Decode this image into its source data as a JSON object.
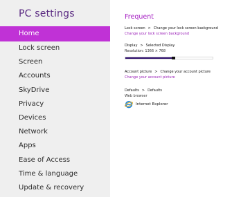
{
  "sidebar": {
    "title": "PC settings",
    "items": [
      {
        "label": "Home",
        "selected": true
      },
      {
        "label": "Lock screen",
        "selected": false
      },
      {
        "label": "Screen",
        "selected": false
      },
      {
        "label": "Accounts",
        "selected": false
      },
      {
        "label": "SkyDrive",
        "selected": false
      },
      {
        "label": "Privacy",
        "selected": false
      },
      {
        "label": "Devices",
        "selected": false
      },
      {
        "label": "Network",
        "selected": false
      },
      {
        "label": "Apps",
        "selected": false
      },
      {
        "label": "Ease of Access",
        "selected": false
      },
      {
        "label": "Time & language",
        "selected": false
      },
      {
        "label": "Update & recovery",
        "selected": false
      }
    ]
  },
  "main": {
    "section_title": "Frequent",
    "lock_screen": {
      "crumb_a": "Lock screen",
      "separator": ">",
      "crumb_b": "Change your lock screen background",
      "link": "Change your lock screen background"
    },
    "display": {
      "crumb_a": "Display",
      "separator": ">",
      "crumb_b": "Selected Display",
      "resolution": "Resolution: 1366 × 768",
      "resolution_level": 0.55
    },
    "account_picture": {
      "crumb_a": "Account picture",
      "separator": ">",
      "crumb_b": "Change your account picture",
      "link": "Change your account picture"
    },
    "defaults": {
      "crumb_a": "Defaults",
      "separator": ">",
      "crumb_b": "Defaults",
      "label": "Web browser",
      "app_name": "Internet Explorer",
      "app_icon": "internet-explorer-icon"
    }
  },
  "colors": {
    "sidebar_bg": "#efefef",
    "accent": "#c032d6",
    "title": "#5a2a82",
    "link": "#9a1fb8",
    "slider_fill": "#2a0a6b"
  }
}
